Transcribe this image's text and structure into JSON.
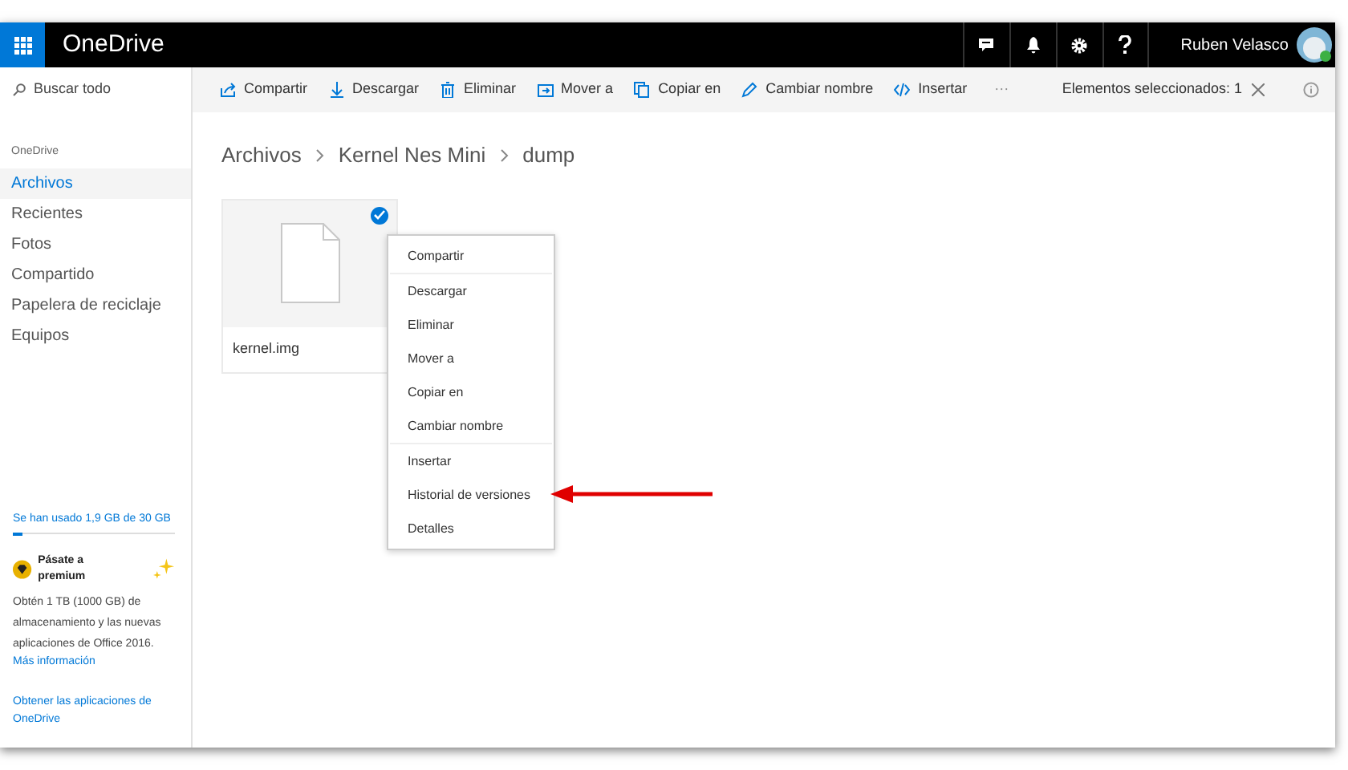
{
  "app_bar": {
    "title": "OneDrive",
    "user": "Ruben Velasco"
  },
  "search": {
    "placeholder": "Buscar todo"
  },
  "commands": [
    {
      "label": "Compartir",
      "kind": "share"
    },
    {
      "label": "Descargar",
      "kind": "download"
    },
    {
      "label": "Eliminar",
      "kind": "delete"
    },
    {
      "label": "Mover a",
      "kind": "move"
    },
    {
      "label": "Copiar en",
      "kind": "copy"
    },
    {
      "label": "Cambiar nombre",
      "kind": "rename"
    },
    {
      "label": "Insertar",
      "kind": "embed"
    },
    {
      "label": "···",
      "kind": "more"
    }
  ],
  "selection": {
    "label": "Elementos seleccionados: 1"
  },
  "sidebar": {
    "heading": "OneDrive",
    "items": [
      {
        "label": "Archivos",
        "selected": true
      },
      {
        "label": "Recientes",
        "selected": false
      },
      {
        "label": "Fotos",
        "selected": false
      },
      {
        "label": "Compartido",
        "selected": false
      },
      {
        "label": "Papelera de reciclaje",
        "selected": false
      },
      {
        "label": "Equipos",
        "selected": false
      }
    ],
    "storage": {
      "label": "Se han usado 1,9 GB de 30 GB",
      "level": 0.06
    },
    "premium": {
      "title": "Pásate a premium",
      "text": "Obtén 1 TB (1000 GB) de almacenamiento y las nuevas aplicaciones de Office 2016.",
      "link": "Más información"
    },
    "apps_link": "Obtener las aplicaciones de OneDrive"
  },
  "breadcrumb": [
    "Archivos",
    "Kernel Nes Mini",
    "dump"
  ],
  "files": [
    {
      "name": "kernel.img",
      "selected": true
    }
  ],
  "context_menu": {
    "groups": [
      [
        "Compartir"
      ],
      [
        "Descargar",
        "Eliminar",
        "Mover a",
        "Copiar en",
        "Cambiar nombre"
      ],
      [
        "Insertar",
        "Historial de versiones",
        "Detalles"
      ]
    ]
  }
}
